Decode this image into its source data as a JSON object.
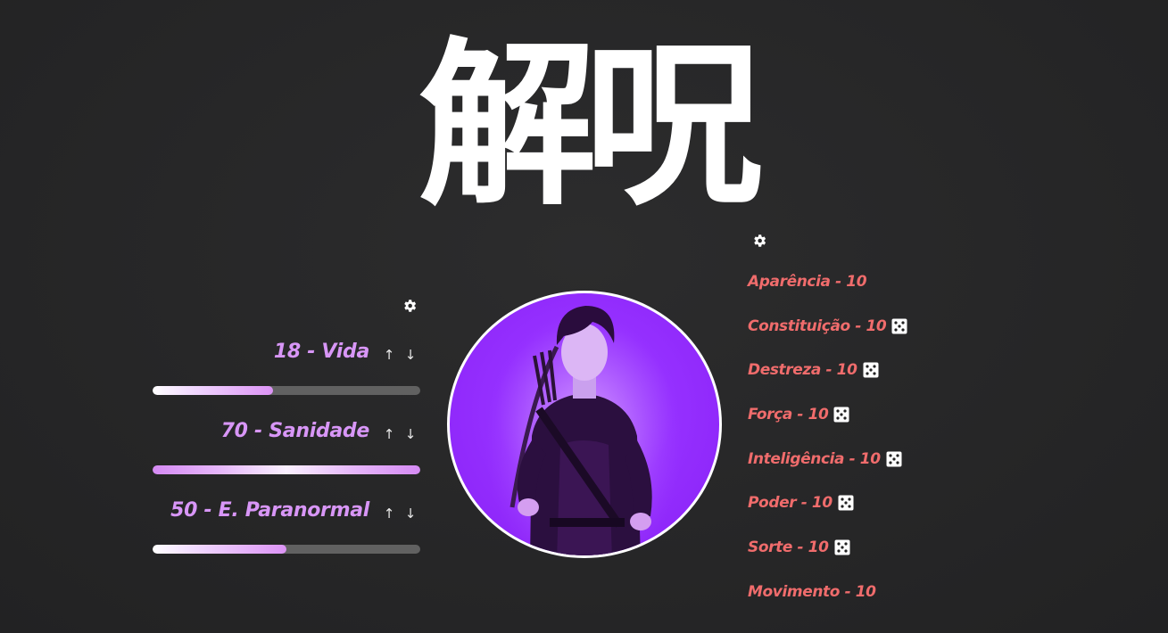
{
  "app": {
    "title": "解呪"
  },
  "status": {
    "settings_icon": "gear-icon",
    "items": [
      {
        "label": "18 - Vida",
        "value": 18,
        "fill_fraction": 0.45
      },
      {
        "label": "70 - Sanidade",
        "value": 70,
        "fill_fraction": 1.0
      },
      {
        "label": "50 - E. Paranormal",
        "value": 50,
        "fill_fraction": 0.5
      }
    ],
    "up_icon": "↑",
    "down_icon": "↓"
  },
  "attributes": {
    "settings_icon": "gear-icon",
    "items": [
      {
        "label": "Aparência - 10",
        "has_dice": false
      },
      {
        "label": "Constituição - 10",
        "has_dice": true
      },
      {
        "label": "Destreza - 10",
        "has_dice": true
      },
      {
        "label": "Força - 10",
        "has_dice": true
      },
      {
        "label": "Inteligência - 10",
        "has_dice": true
      },
      {
        "label": "Poder - 10",
        "has_dice": true
      },
      {
        "label": "Sorte - 10",
        "has_dice": true
      },
      {
        "label": "Movimento - 10",
        "has_dice": false
      }
    ]
  },
  "colors": {
    "background": "#262627",
    "status_label": "#d896f7",
    "attribute_label": "#f06c6c",
    "bar_track": "#616161",
    "avatar_bg": "#9530ff"
  }
}
